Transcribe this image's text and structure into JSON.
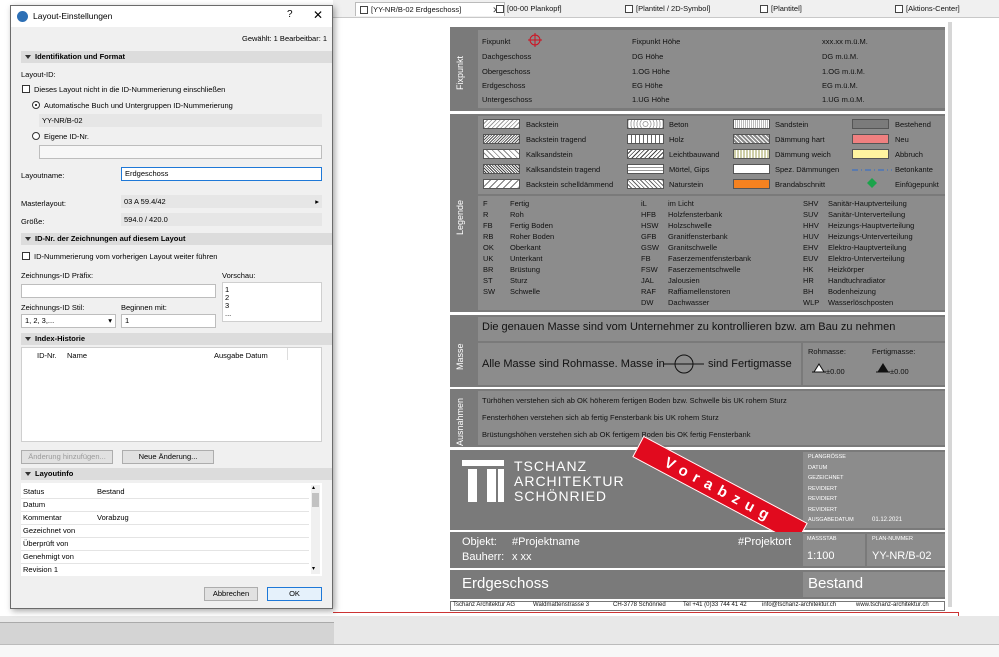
{
  "tabs": [
    {
      "label": "[YY-NR/B-02 Erdgeschoss]",
      "active": true
    },
    {
      "label": "[00-00 Plankopf]"
    },
    {
      "label": "[Plantitel / 2D-Symbol]"
    },
    {
      "label": "[Plantitel]"
    },
    {
      "label": "[Aktions-Center]"
    }
  ],
  "dialog": {
    "title": "Layout-Einstellungen",
    "help": "?",
    "close": "✕",
    "selection_info": "Gewählt: 1 Bearbeitbar: 1",
    "sections": {
      "ident": "Identifikation und Format",
      "idnr": "ID-Nr. der Zeichnungen auf diesem Layout",
      "index": "Index-Historie",
      "info": "Layoutinfo"
    },
    "layout_id_label": "Layout-ID:",
    "exclude_label": "Dieses Layout nicht in die ID-Nummerierung einschließen",
    "auto_label": "Automatische Buch und Untergruppen ID-Nummerierung",
    "auto_value": "YY-NR/B-02",
    "own_label": "Eigene ID-Nr.",
    "own_value": "",
    "layoutname_label": "Layoutname:",
    "layoutname_value": "Erdgeschoss",
    "master_label": "Masterlayout:",
    "master_value": "03 A 59.4/42",
    "size_label": "Größe:",
    "size_value": "594.0 / 420.0",
    "continue_label": "ID-Nummerierung vom vorherigen Layout weiter führen",
    "prefix_label": "Zeichnungs-ID Präfix:",
    "prefix_value": "",
    "preview_label": "Vorschau:",
    "preview_items": [
      "1",
      "2",
      "3",
      "..."
    ],
    "style_label": "Zeichnungs-ID Stil:",
    "style_value": "1, 2, 3,...",
    "start_label": "Beginnen mit:",
    "start_value": "1",
    "index_columns": [
      "ID-Nr.",
      "Name",
      "Ausgabe Datum"
    ],
    "btn_add_change": "Änderung hinzufügen...",
    "btn_new_change": "Neue Änderung...",
    "info_rows": [
      {
        "key": "Status",
        "value": "Bestand"
      },
      {
        "key": "Datum",
        "value": ""
      },
      {
        "key": "Kommentar",
        "value": "Vorabzug"
      },
      {
        "key": "Gezeichnet von",
        "value": ""
      },
      {
        "key": "Überprüft von",
        "value": ""
      },
      {
        "key": "Genehmigt von",
        "value": ""
      },
      {
        "key": "Revision 1",
        "value": ""
      }
    ],
    "btn_cancel": "Abbrechen",
    "btn_ok": "OK"
  },
  "titleblock": {
    "fixpunkt_label": "Fixpunkt",
    "fixpunkt_rows": [
      [
        "Fixpunkt",
        "Fixpunkt Höhe",
        "xxx.xx m.ü.M."
      ],
      [
        "Dachgeschoss",
        "DG Höhe",
        "DG m.ü.M."
      ],
      [
        "Obergeschoss",
        "1.OG Höhe",
        "1.OG m.ü.M."
      ],
      [
        "Erdgeschoss",
        "EG Höhe",
        "EG m.ü.M."
      ],
      [
        "Untergeschoss",
        "1.UG Höhe",
        "1.UG m.ü.M."
      ]
    ],
    "legende_label": "Legende",
    "materials": [
      [
        "Backstein",
        "Beton",
        "Sandstein",
        "Bestehend"
      ],
      [
        "Backstein tragend",
        "Holz",
        "Dämmung hart",
        "Neu"
      ],
      [
        "Kalksandstein",
        "Leichtbauwand",
        "Dämmung weich",
        "Abbruch"
      ],
      [
        "Kalksandstein tragend",
        "Mörtel, Gips",
        "Spez. Dämmungen",
        "Betonkante"
      ],
      [
        "Backstein schelldämmend",
        "Naturstein",
        "Brandabschnitt",
        "Einfügepunkt"
      ]
    ],
    "abbrev_col1": [
      [
        "F",
        "Fertig"
      ],
      [
        "R",
        "Roh"
      ],
      [
        "FB",
        "Fertig Boden"
      ],
      [
        "RB",
        "Roher Boden"
      ],
      [
        "OK",
        "Oberkant"
      ],
      [
        "UK",
        "Unterkant"
      ],
      [
        "BR",
        "Brüstung"
      ],
      [
        "ST",
        "Sturz"
      ],
      [
        "SW",
        "Schwelle"
      ]
    ],
    "abbrev_col2": [
      [
        "iL",
        "im Licht"
      ],
      [
        "HFB",
        "Holzfensterbank"
      ],
      [
        "HSW",
        "Holzschwelle"
      ],
      [
        "GFB",
        "Granitfensterbank"
      ],
      [
        "GSW",
        "Granitschwelle"
      ],
      [
        "FB",
        "Faserzementfensterbank"
      ],
      [
        "FSW",
        "Faserzementschwelle"
      ],
      [
        "JAL",
        "Jalousien"
      ],
      [
        "RAF",
        "Raffiamellenstoren"
      ],
      [
        "DW",
        "Dachwasser"
      ]
    ],
    "abbrev_col3": [
      [
        "SHV",
        "Sanitär-Hauptverteilung"
      ],
      [
        "SUV",
        "Sanitär-Unterverteilung"
      ],
      [
        "HHV",
        "Heizungs-Hauptverteilung"
      ],
      [
        "HUV",
        "Heizungs-Unterverteilung"
      ],
      [
        "EHV",
        "Elektro-Hauptverteilung"
      ],
      [
        "EUV",
        "Elektro-Unterverteilung"
      ],
      [
        "HK",
        "Heizkörper"
      ],
      [
        "HR",
        "Handtuchradiator"
      ],
      [
        "BH",
        "Bodenheizung"
      ],
      [
        "WLP",
        "Wasserlöschposten"
      ]
    ],
    "masse_label": "Masse",
    "masse_line1": "Die genauen Masse sind vom Unternehmer zu kontrollieren bzw. am Bau zu nehmen",
    "masse_line2a": "Alle Masse sind Rohmasse. Masse in",
    "masse_line2b": "sind Fertigmasse",
    "rohmass": "Rohmasse:",
    "fertigmass": "Fertigmasse:",
    "rohmass_val": "±0.00",
    "fertigmass_val": "±0.00",
    "ausnahmen_label": "Ausnahmen",
    "ausnahmen": [
      "Türhöhen verstehen sich ab OK höherem fertigen Boden bzw. Schwelle bis UK rohem Sturz",
      "Fensterhöhen verstehen sich ab fertig Fensterbank bis UK rohem Sturz",
      "Brüstungshöhen verstehen sich ab OK fertigem Boden bis OK fertig Fensterbank"
    ],
    "logo_line1": "TSCHANZ",
    "logo_line2": "ARCHITEKTUR",
    "logo_line3": "SCHÖNRIED",
    "logo_mark": "TT",
    "stamp": "Vorabzug",
    "meta_keys": [
      "PLANGRÖSSE",
      "DATUM",
      "GEZEICHNET",
      "REVIDIERT",
      "REVIDIERT",
      "REVIDIERT",
      "AUSGABEDATUM"
    ],
    "meta_date": "01.12.2021",
    "objekt_label": "Objekt:",
    "objekt_value": "#Projektname",
    "projektort": "#Projektort",
    "bauherr_label": "Bauherr:",
    "bauherr_value": "x xx",
    "massstab_label": "MASSSTAB",
    "massstab_value": "1:100",
    "plannr_label": "PLAN-NUMMER",
    "plannr_value": "YY-NR/B-02",
    "plan_title": "Erdgeschoss",
    "plan_status": "Bestand",
    "footer": [
      "Tschanz Architektur AG",
      "Waldmattenstrasse 3",
      "CH-3778 Schönried",
      "Tel +41 (0)33 744 41 42",
      "info@tschanz-architektur.ch",
      "www.tschanz-architektur.ch"
    ]
  },
  "colors": {
    "block_bg": "#7a7a7a",
    "row_bg": "#8c8c8c",
    "stamp_red": "#e10a1e",
    "neu": "#f08080",
    "abbruch": "#fff4a0",
    "brand": "#f58220",
    "accent": "#1e78d7"
  }
}
